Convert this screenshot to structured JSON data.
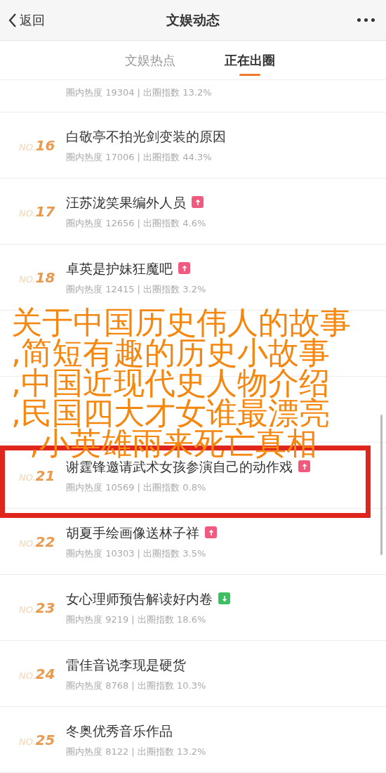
{
  "nav": {
    "back": "返回",
    "title": "文娱动态"
  },
  "tabs": [
    {
      "label": "文娱热点",
      "selected": false
    },
    {
      "label": "正在出圈",
      "selected": true
    }
  ],
  "rows": [
    {
      "kind": "cut",
      "meta": "圈内热度 19304 | 出圈指数 13.2%"
    },
    {
      "rank_label": "NO.",
      "rank": "16",
      "title": "白敬亭不拍光剑变装的原因",
      "meta": "圈内热度 17006 | 出圈指数 44.3%"
    },
    {
      "rank_label": "NO.",
      "rank": "17",
      "title": "汪苏泷笑果编外人员",
      "rising": true,
      "meta": "圈内热度 12656 | 出圈指数 4.6%"
    },
    {
      "rank_label": "NO.",
      "rank": "18",
      "title": "卓英是护妹狂魔吧",
      "rising": true,
      "meta": "圈内热度 12415 | 出圈指数 3.2%"
    },
    {
      "kind": "covered"
    },
    {
      "kind": "covered"
    },
    {
      "rank_label": "NO.",
      "rank": "21",
      "title": "谢霆锋邀请武术女孩参演自己的动作戏",
      "rising": true,
      "meta": "圈内热度 10569 | 出圈指数 0.8%",
      "highlighted": true
    },
    {
      "rank_label": "NO.",
      "rank": "22",
      "title": "胡夏手绘画像送林子祥",
      "rising": true,
      "meta": "圈内热度 10303 | 出圈指数 3.5%"
    },
    {
      "rank_label": "NO.",
      "rank": "23",
      "title": "女心理师预告解读好内卷",
      "rising": false,
      "meta": "圈内热度 9219 | 出圈指数 18.6%"
    },
    {
      "rank_label": "NO.",
      "rank": "24",
      "title": "雷佳音说李现是硬货",
      "meta": "圈内热度 8768 | 出圈指数 10.3%"
    },
    {
      "rank_label": "NO.",
      "rank": "25",
      "title": "冬奥优秀音乐作品",
      "meta": "圈内热度 8122 | 出圈指数 13.2%"
    }
  ],
  "caption": [
    "关于中国历史伟人的故事",
    ",简短有趣的历史小故事",
    ",中国近现代史人物介绍",
    ",民国四大才女谁最漂亮",
    ",小英雄雨来死亡真相"
  ]
}
